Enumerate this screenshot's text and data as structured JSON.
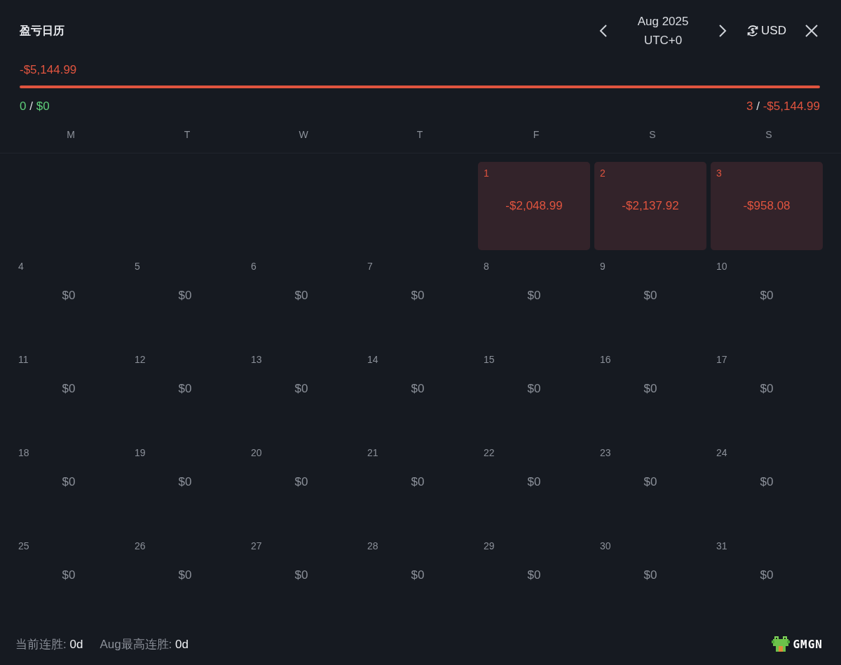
{
  "header": {
    "title": "盈亏日历",
    "month": "Aug 2025",
    "timezone": "UTC+0",
    "currency": "USD"
  },
  "summary": {
    "total": "-$5,144.99",
    "level": 0,
    "wins_count": "0",
    "wins_separator": "/",
    "wins_amount": "$0",
    "losses_count": "3",
    "losses_separator": "/",
    "losses_amount": "-$5,144.99"
  },
  "weekdays": [
    "M",
    "T",
    "W",
    "T",
    "F",
    "S",
    "S"
  ],
  "weeks": [
    [
      {
        "kind": "empty"
      },
      {
        "kind": "empty"
      },
      {
        "kind": "empty"
      },
      {
        "kind": "empty"
      },
      {
        "kind": "loss",
        "day": "1",
        "value": "-$2,048.99"
      },
      {
        "kind": "loss",
        "day": "2",
        "value": "-$2,137.92"
      },
      {
        "kind": "loss",
        "day": "3",
        "value": "-$958.08"
      }
    ],
    [
      {
        "kind": "flat",
        "day": "4",
        "value": "$0"
      },
      {
        "kind": "flat",
        "day": "5",
        "value": "$0"
      },
      {
        "kind": "flat",
        "day": "6",
        "value": "$0"
      },
      {
        "kind": "flat",
        "day": "7",
        "value": "$0"
      },
      {
        "kind": "flat",
        "day": "8",
        "value": "$0"
      },
      {
        "kind": "flat",
        "day": "9",
        "value": "$0"
      },
      {
        "kind": "flat",
        "day": "10",
        "value": "$0"
      }
    ],
    [
      {
        "kind": "flat",
        "day": "11",
        "value": "$0"
      },
      {
        "kind": "flat",
        "day": "12",
        "value": "$0"
      },
      {
        "kind": "flat",
        "day": "13",
        "value": "$0"
      },
      {
        "kind": "flat",
        "day": "14",
        "value": "$0"
      },
      {
        "kind": "flat",
        "day": "15",
        "value": "$0"
      },
      {
        "kind": "flat",
        "day": "16",
        "value": "$0"
      },
      {
        "kind": "flat",
        "day": "17",
        "value": "$0"
      }
    ],
    [
      {
        "kind": "flat",
        "day": "18",
        "value": "$0"
      },
      {
        "kind": "flat",
        "day": "19",
        "value": "$0"
      },
      {
        "kind": "flat",
        "day": "20",
        "value": "$0"
      },
      {
        "kind": "flat",
        "day": "21",
        "value": "$0"
      },
      {
        "kind": "flat",
        "day": "22",
        "value": "$0"
      },
      {
        "kind": "flat",
        "day": "23",
        "value": "$0"
      },
      {
        "kind": "flat",
        "day": "24",
        "value": "$0"
      }
    ],
    [
      {
        "kind": "flat",
        "day": "25",
        "value": "$0"
      },
      {
        "kind": "flat",
        "day": "26",
        "value": "$0"
      },
      {
        "kind": "flat",
        "day": "27",
        "value": "$0"
      },
      {
        "kind": "flat",
        "day": "28",
        "value": "$0"
      },
      {
        "kind": "flat",
        "day": "29",
        "value": "$0"
      },
      {
        "kind": "flat",
        "day": "30",
        "value": "$0"
      },
      {
        "kind": "flat",
        "day": "31",
        "value": "$0"
      }
    ]
  ],
  "footer": {
    "streak_label": "当前连胜:",
    "streak_value": "0d",
    "best_label": "Aug最高连胜:",
    "best_value": "0d",
    "brand": "GMGN"
  }
}
